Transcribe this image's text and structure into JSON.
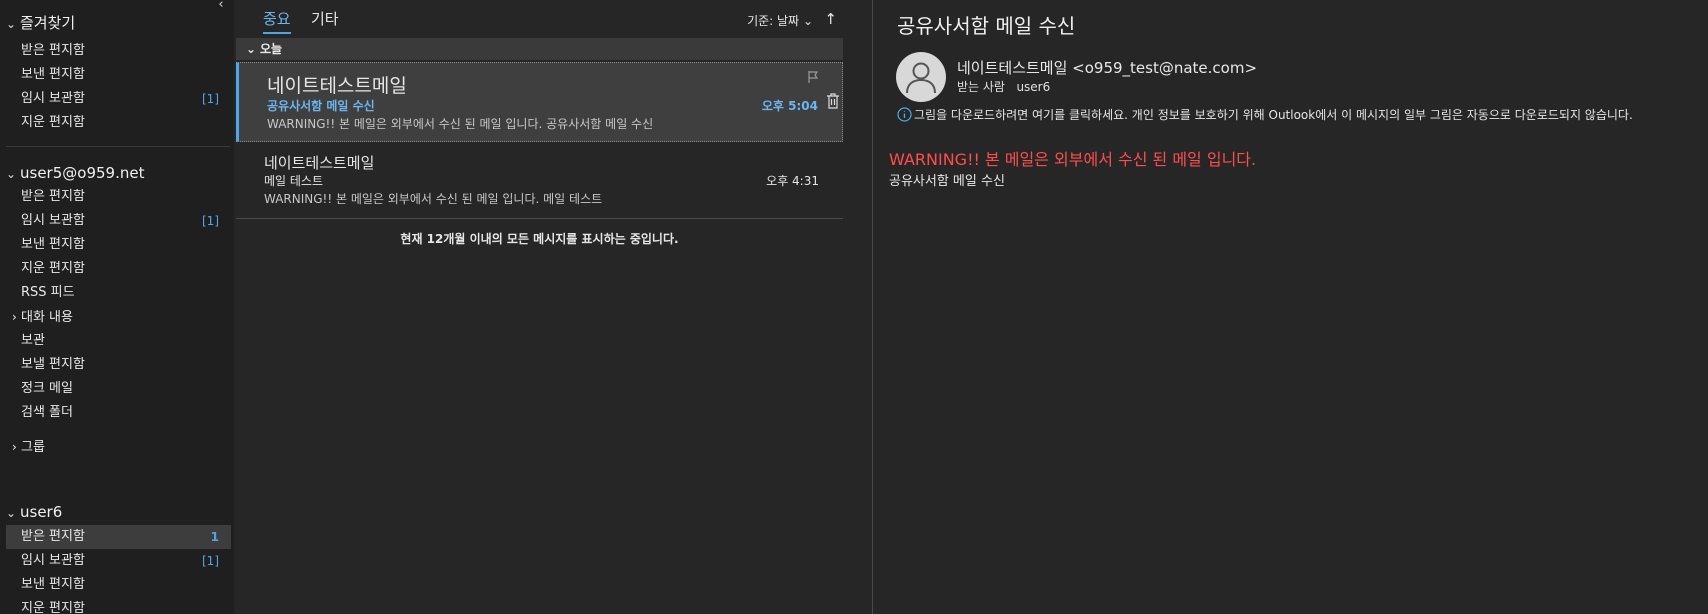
{
  "sidebar": {
    "favorites": {
      "title": "즐겨찾기",
      "items": [
        {
          "label": "받은 편지함",
          "count": ""
        },
        {
          "label": "보낸 편지함",
          "count": ""
        },
        {
          "label": "임시 보관함",
          "count": "[1]"
        },
        {
          "label": "지운 편지함",
          "count": ""
        }
      ]
    },
    "account1": {
      "title": "user5@o959.net",
      "items": [
        {
          "label": "받은 편지함",
          "count": ""
        },
        {
          "label": "임시 보관함",
          "count": "[1]"
        },
        {
          "label": "보낸 편지함",
          "count": ""
        },
        {
          "label": "지운 편지함",
          "count": ""
        },
        {
          "label": "RSS 피드",
          "count": ""
        },
        {
          "label": "대화 내용",
          "count": ""
        },
        {
          "label": "보관",
          "count": ""
        },
        {
          "label": "보낼 편지함",
          "count": ""
        },
        {
          "label": "정크 메일",
          "count": ""
        },
        {
          "label": "검색 폴더",
          "count": ""
        }
      ],
      "group_label": "그룹"
    },
    "account2": {
      "title": "user6",
      "items": [
        {
          "label": "받은 편지함",
          "count": "1"
        },
        {
          "label": "임시 보관함",
          "count": "[1]"
        },
        {
          "label": "보낸 편지함",
          "count": ""
        },
        {
          "label": "지운 편지함",
          "count": ""
        }
      ]
    }
  },
  "list": {
    "tabs": [
      "중요",
      "기타"
    ],
    "sort_label": "기준: 날짜",
    "group_header": "오늘",
    "messages": [
      {
        "sender": "네이트테스트메일",
        "subject": "공유사서함 메일 수신",
        "preview": "WARNING!! 본 메일은 외부에서 수신 된 메일 입니다.  공유사서함 메일 수신",
        "time": "오후 5:04"
      },
      {
        "sender": "네이트테스트메일",
        "subject": "메일 테스트",
        "preview": "WARNING!! 본 메일은 외부에서 수신 된 메일 입니다.  메일 테스트",
        "time": "오후 4:31"
      }
    ],
    "notice": "현재 12개월 이내의 모든 메시지를 표시하는 중입니다."
  },
  "reading": {
    "subject": "공유사서함 메일 수신",
    "from": "네이트테스트메일 <o959_test@nate.com>",
    "to_label": "받는 사람",
    "to_value": "user6",
    "info": "그림을 다운로드하려면 여기를 클릭하세요. 개인 정보를 보호하기 위해 Outlook에서 이 메시지의 일부 그림은 자동으로 다운로드되지 않습니다.",
    "warning": "WARNING!! 본 메일은 외부에서 수신 된 메일 입니다.",
    "body": "공유사서함 메일 수신"
  },
  "colors": {
    "accent": "#4ea6ea",
    "warning": "#ff4d4d",
    "background": "#262626",
    "sidebar": "#1f1f1f"
  }
}
